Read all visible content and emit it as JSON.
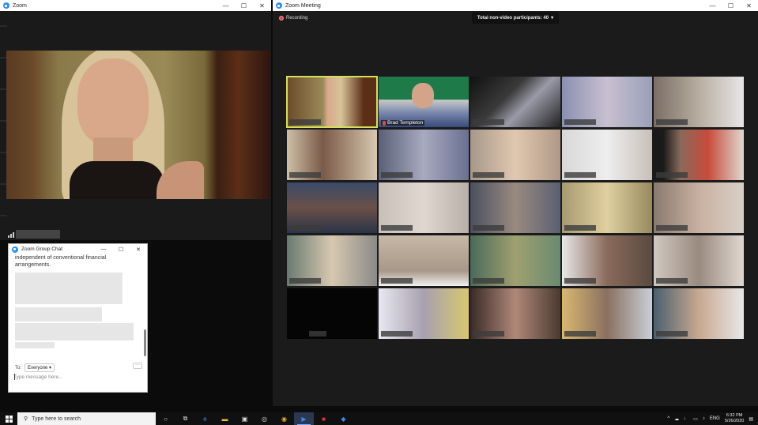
{
  "left_window": {
    "title": "Zoom",
    "controls": {
      "minimize": "—",
      "maximize": "☐",
      "close": "✕"
    }
  },
  "chat_window": {
    "title": "Zoom Group Chat",
    "controls": {
      "minimize": "—",
      "maximize": "☐",
      "close": "✕"
    },
    "visible_message": "independent of conventional financial arrangements.",
    "to_label": "To:",
    "to_value": "Everyone",
    "more_label": "···",
    "input_placeholder": "Type message here..."
  },
  "meeting_window": {
    "title": "Zoom Meeting",
    "controls": {
      "minimize": "—",
      "maximize": "☐",
      "close": "✕"
    },
    "recording_label": "Recording",
    "participants_pill": "Total non-video participants: 40",
    "named_participant": "Brad Templeton"
  },
  "taskbar": {
    "search_placeholder": "Type here to search",
    "language": "ENG",
    "time": "6:32 PM",
    "date": "5/26/2020"
  },
  "colors": {
    "zoom_blue": "#2d8cff",
    "active_speaker_outline": "#d4e05a",
    "recording_red": "#e24c3a"
  }
}
